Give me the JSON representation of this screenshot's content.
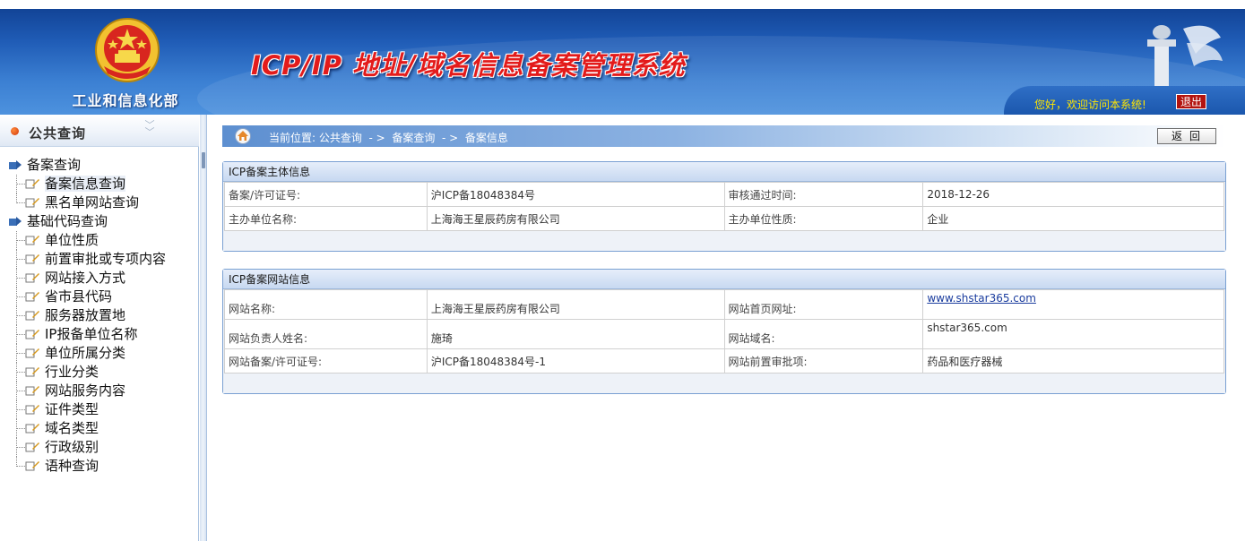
{
  "header": {
    "ministry": "工业和信息化部",
    "system_title": "ICP/IP 地址/域名信息备案管理系统",
    "welcome": "您好，欢迎访问本系统!",
    "logout": "退出"
  },
  "colors": {
    "header_blue": "#1f5bb5",
    "title_red": "#e31b1b",
    "welcome_yellow": "#ffe600",
    "logout_red": "#b3140f"
  },
  "sidebar": {
    "title": "公共查询",
    "collapse_icon": "double-chevron-down-icon",
    "groups": [
      {
        "label": "备案查询",
        "items": [
          "备案信息查询",
          "黑名单网站查询"
        ]
      },
      {
        "label": "基础代码查询",
        "items": [
          "单位性质",
          "前置审批或专项内容",
          "网站接入方式",
          "省市县代码",
          "服务器放置地",
          "IP报备单位名称",
          "单位所属分类",
          "行业分类",
          "网站服务内容",
          "证件类型",
          "域名类型",
          "行政级别",
          "语种查询"
        ]
      }
    ]
  },
  "breadcrumb": {
    "prefix": "当前位置:",
    "items": [
      "公共查询",
      "备案查询",
      "备案信息"
    ],
    "separator": "- >"
  },
  "back_button": "返回",
  "panel1": {
    "title": "ICP备案主体信息",
    "rows": [
      [
        "备案/许可证号:",
        "沪ICP备18048384号",
        "审核通过时间:",
        "2018-12-26"
      ],
      [
        "主办单位名称:",
        "上海海王星辰药房有限公司",
        "主办单位性质:",
        "企业"
      ]
    ]
  },
  "panel2": {
    "title": "ICP备案网站信息",
    "rows": [
      [
        "网站名称:",
        "上海海王星辰药房有限公司",
        "网站首页网址:",
        "www.shstar365.com"
      ],
      [
        "网站负责人姓名:",
        "施琦",
        "网站域名:",
        "shstar365.com"
      ],
      [
        "网站备案/许可证号:",
        "沪ICP备18048384号-1",
        "网站前置审批项:",
        "药品和医疗器械"
      ]
    ]
  }
}
